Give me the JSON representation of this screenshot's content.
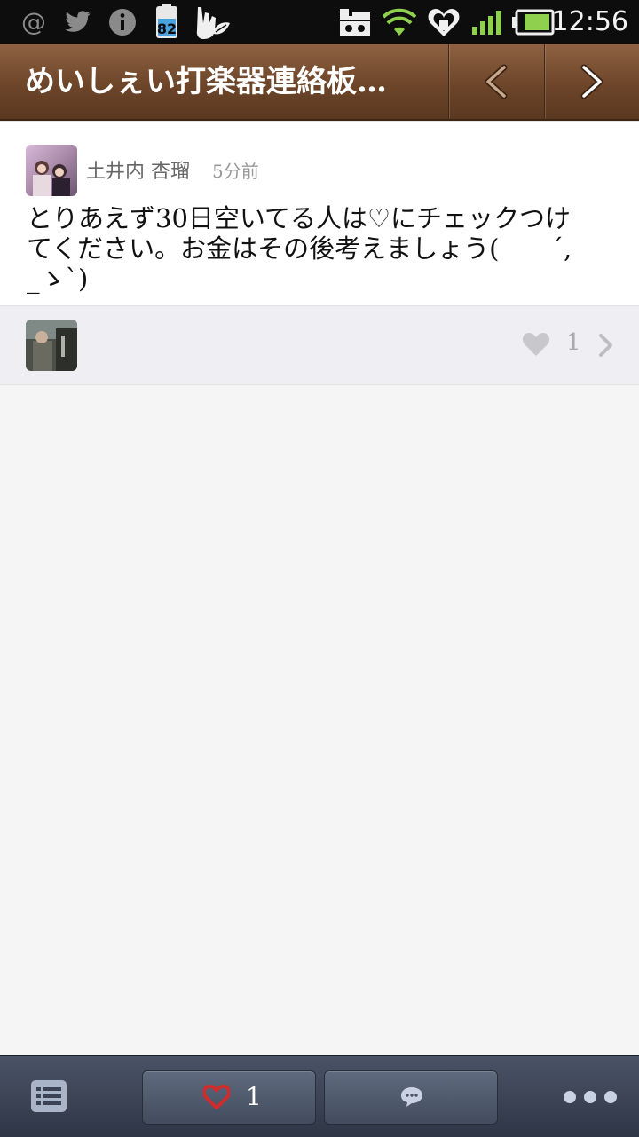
{
  "status_bar": {
    "time": "12:56",
    "notification_badge": "82",
    "icons": [
      "at-icon",
      "twitter-icon",
      "info-icon",
      "battery-saver-icon",
      "finger-leaf-icon",
      "sim-icon",
      "wifi-icon",
      "heart-shield-icon",
      "signal-icon",
      "battery-icon"
    ]
  },
  "header": {
    "title": "めいしぇい打楽器連絡板…",
    "prev_icon": "chevron-left-icon",
    "next_icon": "chevron-right-icon"
  },
  "post": {
    "author": "土井内 杏瑠",
    "time": "5分前",
    "text": "とりあえず30日空いてる人は♡にチェックつけてください。お金はその後考えましょう(　　´,_ゝ`)"
  },
  "reactions": {
    "like_count": "1"
  },
  "bottom_bar": {
    "like_count": "1",
    "icons": [
      "list-menu-icon",
      "heart-icon",
      "comment-bubble-icon",
      "more-dots-icon"
    ]
  },
  "colors": {
    "header_brown": "#6d4529",
    "bottom_bar": "#3a4254",
    "like_red": "#d62a2a"
  }
}
